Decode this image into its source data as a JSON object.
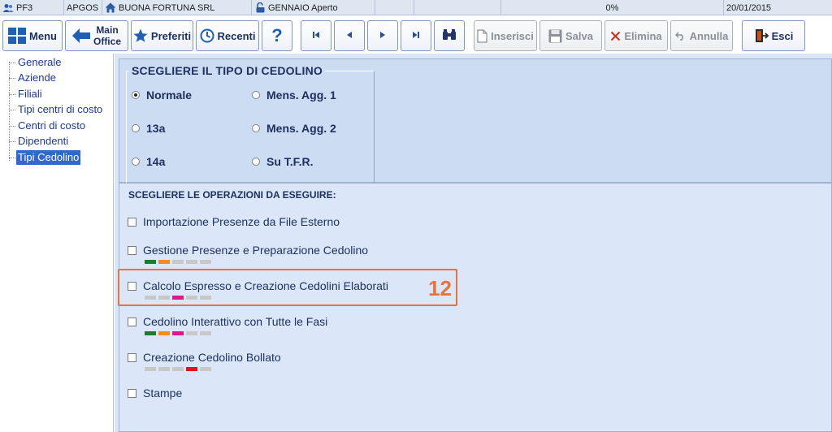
{
  "status_bar": {
    "app": "PF3",
    "user": "APGOS",
    "company": "BUONA FORTUNA SRL",
    "period": "GENNAIO Aperto",
    "progress": "0%",
    "date": "20/01/2015"
  },
  "toolbar": {
    "menu": "Menu",
    "main_office_line1": "Main",
    "main_office_line2": "Office",
    "preferiti": "Preferiti",
    "recenti": "Recenti",
    "help": "?",
    "inserisci": "Inserisci",
    "salva": "Salva",
    "elimina": "Elimina",
    "annulla": "Annulla",
    "esci": "Esci"
  },
  "sidebar": {
    "items": [
      {
        "label": "Generale"
      },
      {
        "label": "Aziende"
      },
      {
        "label": "Filiali"
      },
      {
        "label": "Tipi centri di costo"
      },
      {
        "label": "Centri di costo"
      },
      {
        "label": "Dipendenti"
      },
      {
        "label": "Tipi Cedolino"
      }
    ],
    "selected": "Tipi Cedolino"
  },
  "cedolino_type": {
    "title": "SCEGLIERE IL TIPO DI CEDOLINO",
    "options": [
      {
        "label": "Normale",
        "selected": true
      },
      {
        "label": "Mens. Agg. 1",
        "selected": false
      },
      {
        "label": "13a",
        "selected": false
      },
      {
        "label": "Mens. Agg. 2",
        "selected": false
      },
      {
        "label": "14a",
        "selected": false
      },
      {
        "label": "Su T.F.R.",
        "selected": false
      }
    ]
  },
  "operations": {
    "title": "SCEGLIERE LE OPERAZIONI DA ESEGUIRE:",
    "items": [
      {
        "label": "Importazione Presenze da File Esterno",
        "checked": false,
        "phases": []
      },
      {
        "label": "Gestione Presenze e Preparazione Cedolino",
        "checked": false,
        "phases": [
          "#1e7a2e",
          "#f28c1e",
          "#c8c8c8",
          "#c8c8c8",
          "#c8c8c8"
        ]
      },
      {
        "label": "Calcolo Espresso e Creazione Cedolini Elaborati",
        "checked": false,
        "phases": [
          "#c8c8c8",
          "#c8c8c8",
          "#e0168c",
          "#c8c8c8",
          "#c8c8c8"
        ]
      },
      {
        "label": "Cedolino Interattivo con Tutte le Fasi",
        "checked": false,
        "phases": [
          "#1e7a2e",
          "#f28c1e",
          "#e0168c",
          "#c8c8c8",
          "#c8c8c8"
        ]
      },
      {
        "label": "Creazione Cedolino Bollato",
        "checked": false,
        "phases": [
          "#c8c8c8",
          "#c8c8c8",
          "#c8c8c8",
          "#e0141b",
          "#c8c8c8"
        ]
      },
      {
        "label": "Stampe",
        "checked": false,
        "phases": []
      }
    ],
    "callout_number": "12"
  },
  "colors": {
    "accent": "#e8733a",
    "selection": "#3367c9",
    "text": "#1c2f5e"
  }
}
